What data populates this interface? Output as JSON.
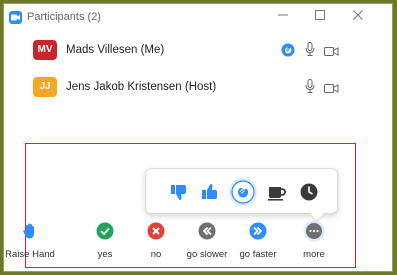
{
  "window": {
    "title": "Participants (2)"
  },
  "participants": [
    {
      "initials": "MV",
      "name": "Mads Villesen (Me)",
      "avatar_color": "#c9252d"
    },
    {
      "initials": "JJ",
      "name": "Jens Jakob Kristensen (Host)",
      "avatar_color": "#f5a623"
    }
  ],
  "reactions": [
    "thumbs-down",
    "thumbs-up",
    "clap",
    "coffee",
    "clock"
  ],
  "feedback": [
    {
      "label": "Raise Hand",
      "icon": "hand-icon"
    },
    {
      "label": "yes",
      "icon": "check-icon"
    },
    {
      "label": "no",
      "icon": "x-icon"
    },
    {
      "label": "go slower",
      "icon": "rewind-icon"
    },
    {
      "label": "go faster",
      "icon": "fast-forward-icon"
    },
    {
      "label": "more",
      "icon": "more-icon"
    }
  ],
  "colors": {
    "accent_blue": "#2d8cff",
    "yes_green": "#21a35a",
    "no_red": "#e0423a",
    "gray": "#707070"
  }
}
